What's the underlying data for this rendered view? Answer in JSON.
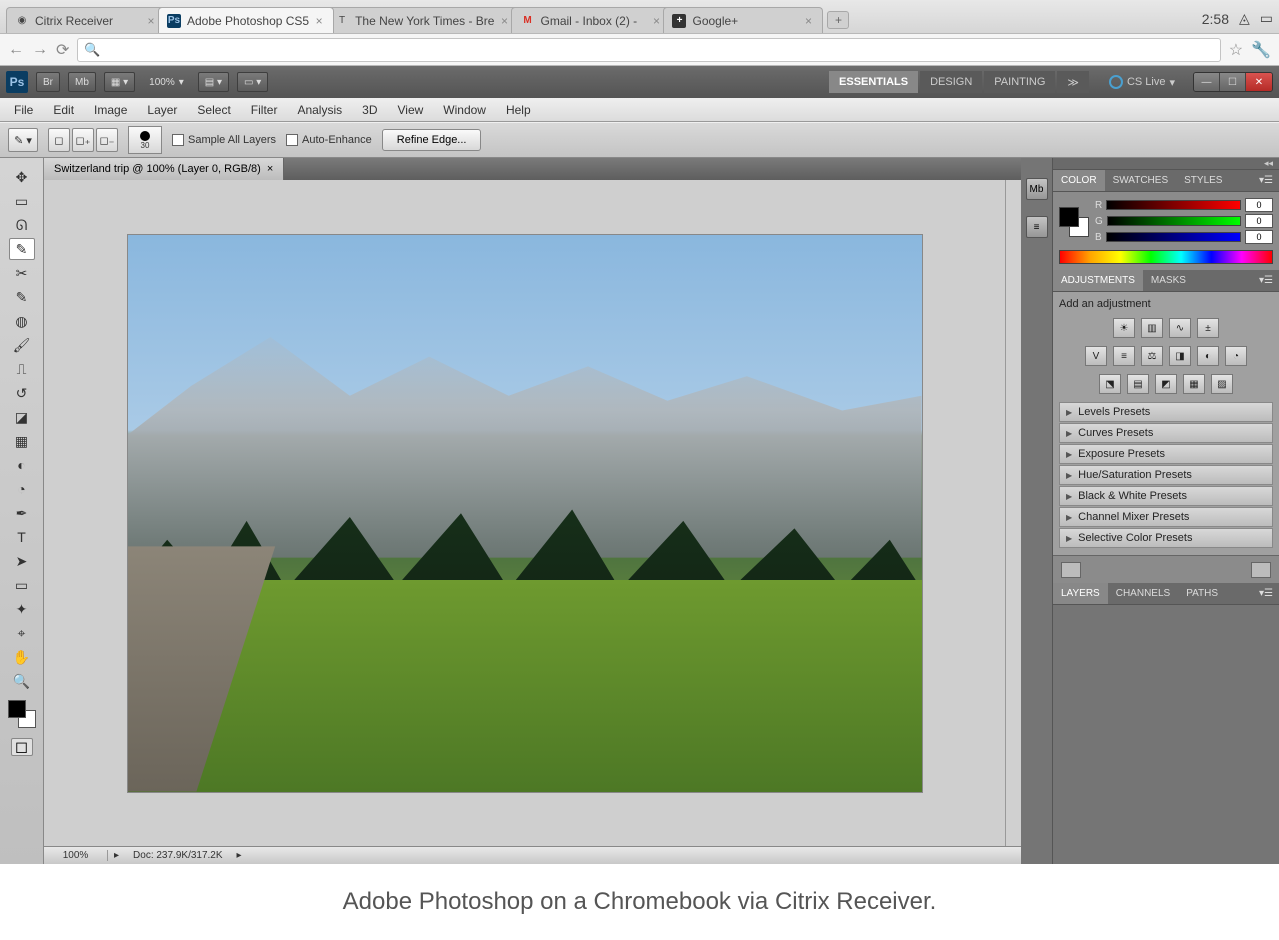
{
  "chromeos": {
    "clock": "2:58",
    "tabs": [
      {
        "title": "Citrix Receiver",
        "icon": "◉"
      },
      {
        "title": "Adobe Photoshop CS5",
        "icon": "Ps",
        "active": true
      },
      {
        "title": "The New York Times - Bre",
        "icon": "T"
      },
      {
        "title": "Gmail - Inbox (2) -",
        "icon": "M"
      },
      {
        "title": "Google+",
        "icon": "+"
      }
    ],
    "omnibox_placeholder": ""
  },
  "ps_appbar": {
    "zoom": "100%",
    "br_label": "Br",
    "mb_label": "Mb",
    "workspaces": [
      "ESSENTIALS",
      "DESIGN",
      "PAINTING"
    ],
    "cs_live": "CS Live"
  },
  "menubar": [
    "File",
    "Edit",
    "Image",
    "Layer",
    "Select",
    "Filter",
    "Analysis",
    "3D",
    "View",
    "Window",
    "Help"
  ],
  "options": {
    "brush_size": "30",
    "sample_all": "Sample All Layers",
    "auto_enhance": "Auto-Enhance",
    "refine": "Refine Edge..."
  },
  "document": {
    "tab_title": "Switzerland trip @ 100% (Layer 0, RGB/8)",
    "status_zoom": "100%",
    "status_doc": "Doc: 237.9K/317.2K"
  },
  "panels": {
    "color_tabs": [
      "COLOR",
      "SWATCHES",
      "STYLES"
    ],
    "rgb": {
      "r": "0",
      "g": "0",
      "b": "0"
    },
    "adj_tabs": [
      "ADJUSTMENTS",
      "MASKS"
    ],
    "adj_hint": "Add an adjustment",
    "presets": [
      "Levels Presets",
      "Curves Presets",
      "Exposure Presets",
      "Hue/Saturation Presets",
      "Black & White Presets",
      "Channel Mixer Presets",
      "Selective Color Presets"
    ],
    "bottom_tabs": [
      "LAYERS",
      "CHANNELS",
      "PATHS"
    ]
  },
  "caption": "Adobe Photoshop on a Chromebook via Citrix Receiver."
}
